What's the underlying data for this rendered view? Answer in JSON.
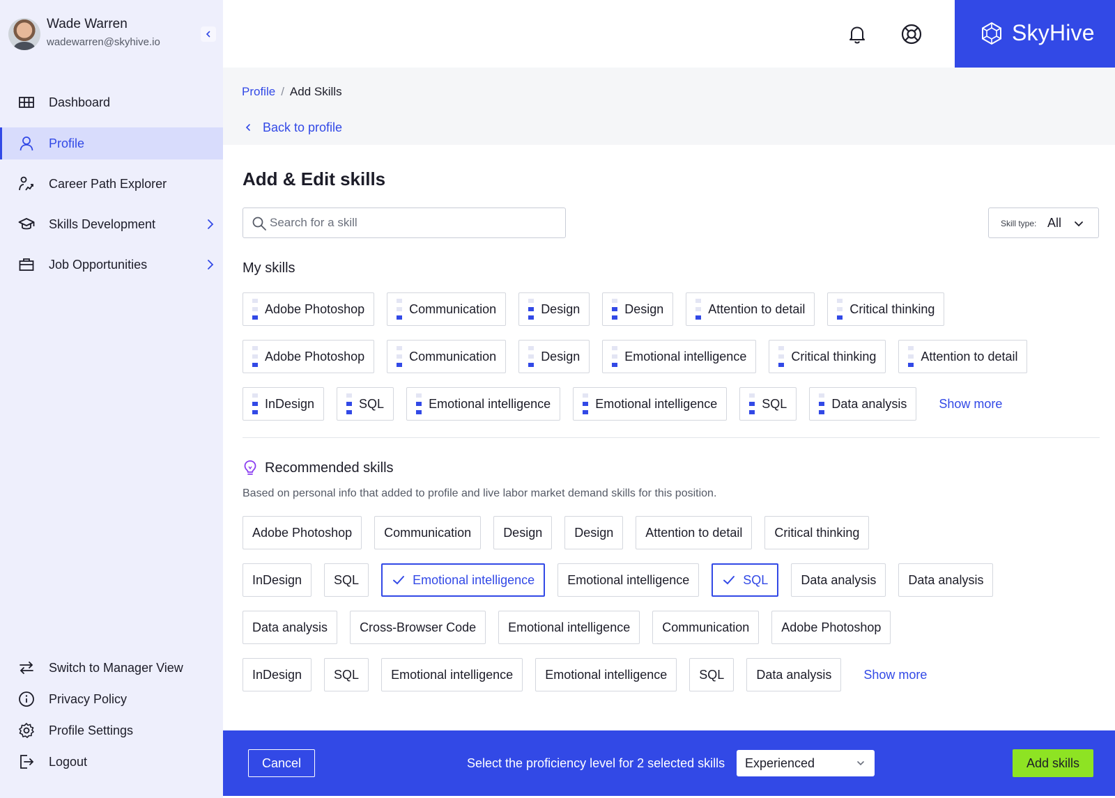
{
  "user": {
    "name": "Wade Warren",
    "email": "wadewarren@skyhive.io"
  },
  "nav": {
    "items": [
      {
        "label": "Dashboard",
        "icon": "dashboard-icon"
      },
      {
        "label": "Profile",
        "icon": "user-icon",
        "active": true
      },
      {
        "label": "Career Path Explorer",
        "icon": "career-path-icon"
      },
      {
        "label": "Skills Development",
        "icon": "graduation-cap-icon",
        "has_submenu": true
      },
      {
        "label": "Job Opportunities",
        "icon": "briefcase-icon",
        "has_submenu": true
      }
    ],
    "bottom_items": [
      {
        "label": "Switch to Manager View",
        "icon": "switch-icon"
      },
      {
        "label": "Privacy Policy",
        "icon": "info-icon"
      },
      {
        "label": "Profile Settings",
        "icon": "settings-icon"
      },
      {
        "label": "Logout",
        "icon": "logout-icon"
      }
    ]
  },
  "brand": {
    "name": "SkyHive",
    "color": "#3249e6"
  },
  "breadcrumb": {
    "parent": "Profile",
    "separator": "/",
    "current": "Add Skills"
  },
  "back_link": "Back to profile",
  "page_title": "Add & Edit skills",
  "search": {
    "placeholder": "Search for a skill",
    "value": ""
  },
  "skill_type": {
    "label": "Skill type:",
    "value": "All"
  },
  "my_skills": {
    "title": "My skills",
    "rows": [
      [
        {
          "label": "Adobe Photoshop",
          "level": 1
        },
        {
          "label": "Communication",
          "level": 1
        },
        {
          "label": "Design",
          "level": 2
        },
        {
          "label": "Design",
          "level": 2
        },
        {
          "label": "Attention to detail",
          "level": 1
        },
        {
          "label": "Critical thinking",
          "level": 1
        }
      ],
      [
        {
          "label": "Adobe Photoshop",
          "level": 1
        },
        {
          "label": "Communication",
          "level": 1
        },
        {
          "label": "Design",
          "level": 1
        },
        {
          "label": "Emotional intelligence",
          "level": 1
        },
        {
          "label": "Critical thinking",
          "level": 1
        },
        {
          "label": "Attention to detail",
          "level": 1
        }
      ],
      [
        {
          "label": "InDesign",
          "level": 2
        },
        {
          "label": "SQL",
          "level": 2
        },
        {
          "label": "Emotional intelligence",
          "level": 2
        },
        {
          "label": "Emotional intelligence",
          "level": 2
        },
        {
          "label": "SQL",
          "level": 2
        },
        {
          "label": "Data analysis",
          "level": 2
        }
      ]
    ],
    "show_more": "Show more"
  },
  "recommended": {
    "title": "Recommended skills",
    "description": "Based on personal info that added to profile and live labor market demand skills for this position.",
    "rows": [
      [
        {
          "label": "Adobe Photoshop"
        },
        {
          "label": "Communication"
        },
        {
          "label": "Design"
        },
        {
          "label": "Design"
        },
        {
          "label": "Attention to detail"
        },
        {
          "label": "Critical thinking"
        }
      ],
      [
        {
          "label": "InDesign"
        },
        {
          "label": "SQL"
        },
        {
          "label": "Emotional intelligence",
          "selected": true
        },
        {
          "label": "Emotional intelligence"
        },
        {
          "label": "SQL",
          "selected": true
        },
        {
          "label": "Data analysis"
        },
        {
          "label": "Data analysis"
        }
      ],
      [
        {
          "label": "Data analysis"
        },
        {
          "label": "Cross-Browser Code"
        },
        {
          "label": "Emotional intelligence"
        },
        {
          "label": "Communication"
        },
        {
          "label": "Adobe Photoshop"
        }
      ],
      [
        {
          "label": "InDesign"
        },
        {
          "label": "SQL"
        },
        {
          "label": "Emotional intelligence"
        },
        {
          "label": "Emotional intelligence"
        },
        {
          "label": "SQL"
        },
        {
          "label": "Data analysis"
        }
      ]
    ],
    "show_more": "Show more"
  },
  "action_bar": {
    "cancel": "Cancel",
    "proficiency_label": "Select the proficiency level for 2 selected skills",
    "proficiency_value": "Experienced",
    "add": "Add skills",
    "add_color": "#8ee323"
  }
}
